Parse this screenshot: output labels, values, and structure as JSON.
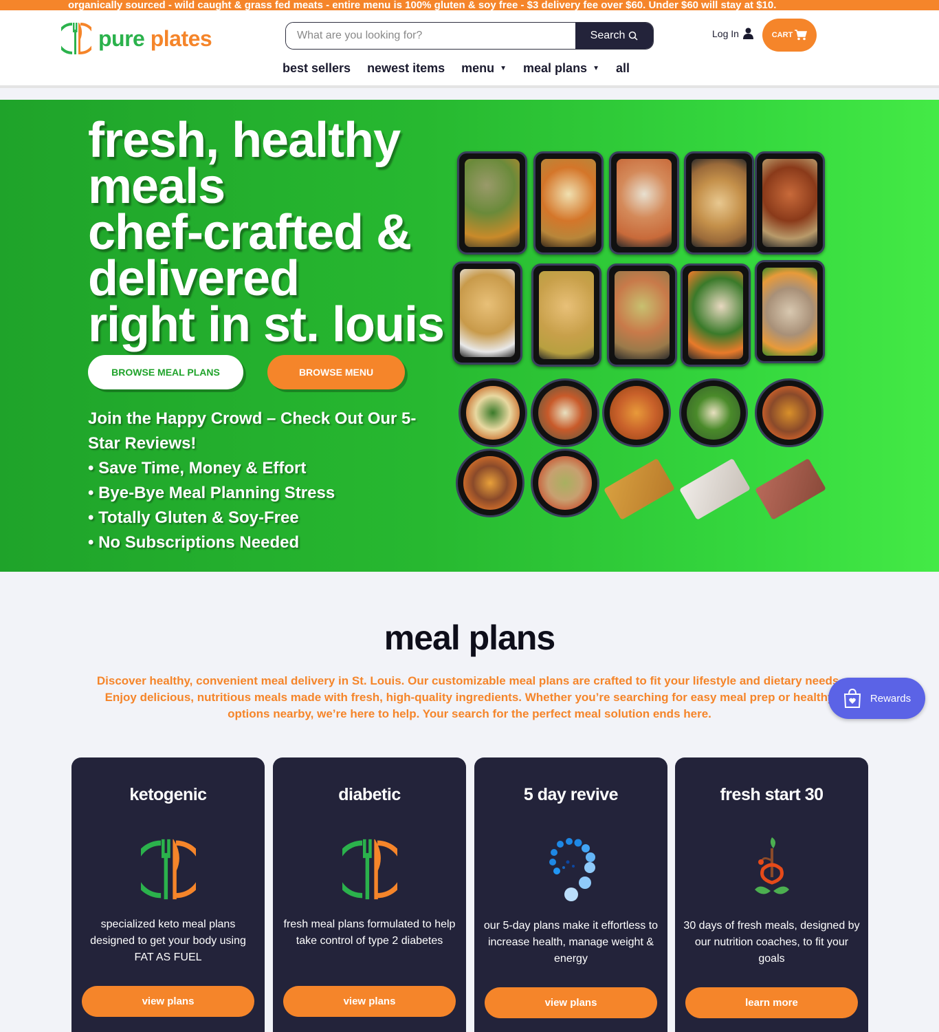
{
  "announcement": "organically sourced - wild caught & grass fed meats - entire menu is 100% gluten & soy free - $3 delivery fee over $60. Under $60 will stay at $10.",
  "header": {
    "logo_word1": "pure",
    "logo_word2": "plates",
    "search_placeholder": "What are you looking for?",
    "search_button": "Search",
    "login_label": "Log In",
    "cart_label": "CART"
  },
  "nav": {
    "best_sellers": "best sellers",
    "newest_items": "newest items",
    "menu": "menu",
    "meal_plans": "meal plans",
    "all": "all"
  },
  "hero": {
    "title_lines": [
      "fresh, healthy",
      "meals",
      "chef-crafted &",
      "delivered",
      "right in st. louis"
    ],
    "btn_meal_plans": "BROWSE MEAL PLANS",
    "btn_menu": "BROWSE MENU",
    "sub_lines": [
      "Join the Happy Crowd – Check Out Our 5-",
      "Star Reviews!",
      "• Save Time, Money & Effort",
      "• Bye-Bye Meal Planning Stress",
      "• Totally Gluten & Soy-Free",
      "• No Subscriptions Needed"
    ]
  },
  "plans": {
    "title": "meal plans",
    "desc_lines": [
      "Discover healthy, convenient meal delivery in St. Louis. Our customizable meal plans are crafted to fit your lifestyle and dietary needs.",
      "Enjoy delicious, nutritious meals made with fresh, high-quality ingredients. Whether you’re searching for easy meal prep or healthy",
      "options nearby, we’re here to help. Your search for the perfect meal solution ends here."
    ],
    "cards": [
      {
        "title": "ketogenic",
        "icon": "fork-knife-logo-icon",
        "desc": "specialized keto meal plans designed to get your body using FAT AS FUEL",
        "cta": "view plans"
      },
      {
        "title": "diabetic",
        "icon": "fork-knife-logo-icon",
        "desc": "fresh meal plans formulated to help take control of type 2 diabetes",
        "cta": "view plans"
      },
      {
        "title": "5 day revive",
        "icon": "blue-dots-spiral-icon",
        "desc": "our 5-day plans make it effortless to increase health, manage weight & energy",
        "cta": "view plans"
      },
      {
        "title": "fresh start 30",
        "icon": "sprout-plant-icon",
        "desc": "30 days of fresh meals, designed by our nutrition coaches, to fit your goals",
        "cta": "learn more"
      }
    ]
  },
  "rewards_label": "Rewards",
  "colors": {
    "orange": "#f5852a",
    "green": "#2bb24c",
    "navy": "#23233a",
    "rewards": "#5b63e6"
  }
}
